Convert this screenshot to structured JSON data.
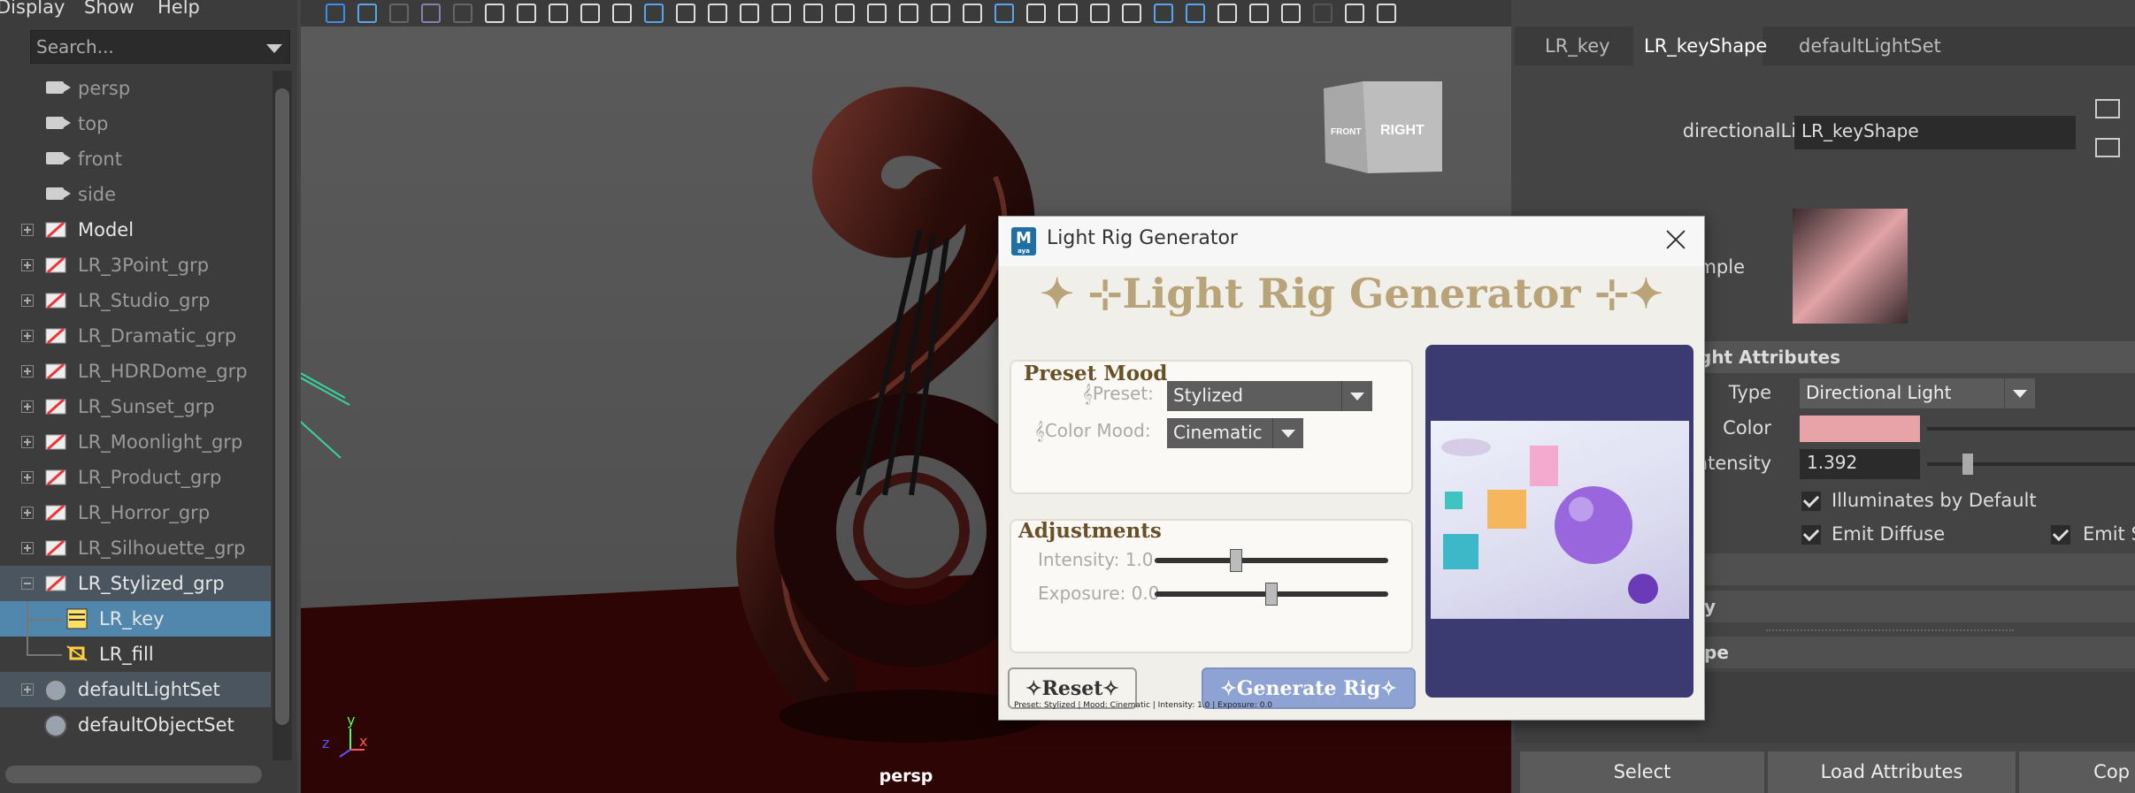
{
  "menu": {
    "items": [
      "Display",
      "Show",
      "Help"
    ]
  },
  "outliner": {
    "search_placeholder": "Search...",
    "rows": [
      {
        "label": "persp",
        "kind": "camera"
      },
      {
        "label": "top",
        "kind": "camera"
      },
      {
        "label": "front",
        "kind": "camera"
      },
      {
        "label": "side",
        "kind": "camera"
      },
      {
        "label": "Model",
        "kind": "group"
      },
      {
        "label": "LR_3Point_grp",
        "kind": "group"
      },
      {
        "label": "LR_Studio_grp",
        "kind": "group"
      },
      {
        "label": "LR_Dramatic_grp",
        "kind": "group"
      },
      {
        "label": "LR_HDRDome_grp",
        "kind": "group"
      },
      {
        "label": "LR_Sunset_grp",
        "kind": "group"
      },
      {
        "label": "LR_Moonlight_grp",
        "kind": "group"
      },
      {
        "label": "LR_Product_grp",
        "kind": "group"
      },
      {
        "label": "LR_Horror_grp",
        "kind": "group"
      },
      {
        "label": "LR_Silhouette_grp",
        "kind": "group"
      },
      {
        "label": "LR_Stylized_grp",
        "kind": "group"
      },
      {
        "label": "LR_key",
        "kind": "light"
      },
      {
        "label": "LR_fill",
        "kind": "light"
      },
      {
        "label": "defaultLightSet",
        "kind": "set"
      },
      {
        "label": "defaultObjectSet",
        "kind": "set"
      }
    ]
  },
  "viewport": {
    "camera_label": "persp",
    "viewcube": {
      "front": "FRONT",
      "right": "RIGHT"
    },
    "axis": {
      "y": "y",
      "x": "x",
      "z": "z"
    }
  },
  "attribute_editor": {
    "tabs": [
      "LR_key",
      "LR_keyShape",
      "defaultLightSet"
    ],
    "node_type_label": "directionalLight:",
    "node_name": "LR_keyShape",
    "sample_label": "Sample",
    "section_light_attributes": "ght Attributes",
    "type_label": "Type",
    "type_value": "Directional Light",
    "color_label": "Color",
    "color_value": "#e7a3a8",
    "intensity_label": "Intensity",
    "intensity_value": "1.392",
    "illuminates_label": "Illuminates by Default",
    "emit_diffuse_label": "Emit Diffuse",
    "emit_specular_label": "Emit S",
    "section_y": "y",
    "section_pe": "pe",
    "buttons": [
      "Select",
      "Load Attributes",
      "Cop"
    ]
  },
  "dialog": {
    "title": "Light Rig Generator",
    "app_icon_text": "M",
    "app_icon_sub": "aya",
    "banner": "✦ ⊹Light Rig Generator ⊹✦",
    "preset_panel_title": "Preset Mood",
    "preset_label": "𝄞Preset:",
    "preset_value": "Stylized",
    "mood_label": "𝄞Color Mood:",
    "mood_value": "Cinematic",
    "adjust_panel_title": "Adjustments",
    "intensity_label": "Intensity: 1.0",
    "intensity_value": 1.0,
    "intensity_fraction": 0.35,
    "exposure_label": "Exposure: 0.0",
    "exposure_fraction": 0.5,
    "reset_label": "✧Reset✧",
    "generate_label": "✧Generate Rig✧",
    "preview_caption": "Preset: Stylized | Mood: Cinematic | Intensity: 1.0 | Exposure: 0.0"
  },
  "colors": {
    "accent_selection": "#5186ad",
    "dialog_title_gold": "#b9a47a",
    "generate_button": "#8ea3d4"
  }
}
